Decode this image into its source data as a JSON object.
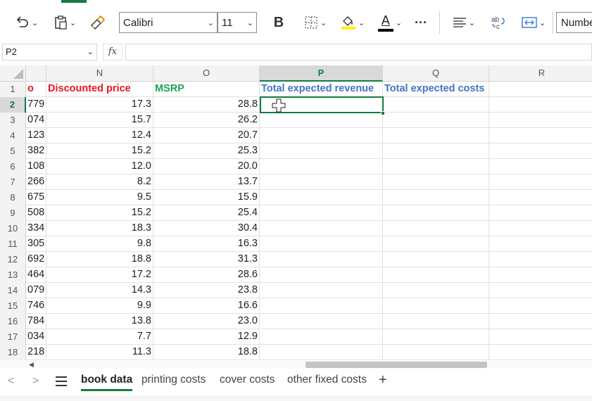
{
  "toolbar": {
    "undo_icon": "undo-icon",
    "clipboard_icon": "clipboard-icon",
    "format_painter_icon": "format-painter-icon",
    "font_name": "Calibri",
    "font_size": "11",
    "bold_label": "B",
    "borders_icon": "borders-icon",
    "fill_color_icon": "fill-color-icon",
    "fill_color": "#ffef00",
    "font_color_label": "A",
    "font_color": "#000000",
    "more_label": "···",
    "align_icon": "align-icon",
    "wrap_icon": "wrap-text-icon",
    "merge_icon": "merge-icon",
    "number_format": "Number",
    "accent_color": "#107c41"
  },
  "formula_bar": {
    "name_box": "P2",
    "fx_label": "fx",
    "formula": ""
  },
  "grid": {
    "columns": [
      "N",
      "O",
      "P",
      "Q",
      "R"
    ],
    "selected_column": "P",
    "selected_row": "2",
    "header_row": {
      "partial": "o",
      "n": "Discounted price",
      "o": "MSRP",
      "p": "Total expected revenue",
      "q": "Total expected costs"
    },
    "rows": [
      {
        "num": "2",
        "m": "779",
        "n": "17.3",
        "o": "28.8"
      },
      {
        "num": "3",
        "m": "074",
        "n": "15.7",
        "o": "26.2"
      },
      {
        "num": "4",
        "m": "123",
        "n": "12.4",
        "o": "20.7"
      },
      {
        "num": "5",
        "m": "382",
        "n": "15.2",
        "o": "25.3"
      },
      {
        "num": "6",
        "m": "108",
        "n": "12.0",
        "o": "20.0"
      },
      {
        "num": "7",
        "m": "266",
        "n": "8.2",
        "o": "13.7"
      },
      {
        "num": "8",
        "m": "675",
        "n": "9.5",
        "o": "15.9"
      },
      {
        "num": "9",
        "m": "508",
        "n": "15.2",
        "o": "25.4"
      },
      {
        "num": "10",
        "m": "334",
        "n": "18.3",
        "o": "30.4"
      },
      {
        "num": "11",
        "m": "305",
        "n": "9.8",
        "o": "16.3"
      },
      {
        "num": "12",
        "m": "692",
        "n": "18.8",
        "o": "31.3"
      },
      {
        "num": "13",
        "m": "464",
        "n": "17.2",
        "o": "28.6"
      },
      {
        "num": "14",
        "m": "079",
        "n": "14.3",
        "o": "23.8"
      },
      {
        "num": "15",
        "m": "746",
        "n": "9.9",
        "o": "16.6"
      },
      {
        "num": "16",
        "m": "784",
        "n": "13.8",
        "o": "23.0"
      },
      {
        "num": "17",
        "m": "034",
        "n": "7.7",
        "o": "12.9"
      },
      {
        "num": "18",
        "m": "218",
        "n": "11.3",
        "o": "18.8"
      }
    ]
  },
  "sheets": {
    "tabs": [
      "book data",
      "printing costs",
      "cover costs",
      "other fixed costs"
    ],
    "active": "book data",
    "add_label": "+",
    "prev_label": "<",
    "next_label": ">"
  }
}
